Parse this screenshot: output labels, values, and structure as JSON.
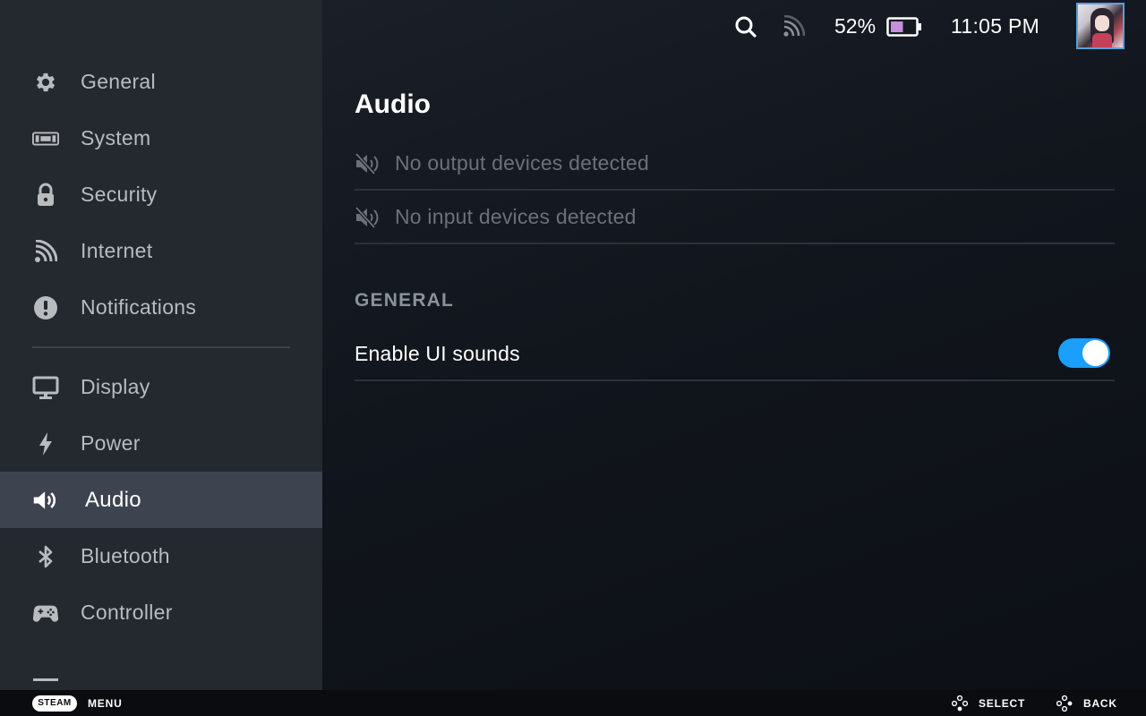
{
  "sidebar": {
    "items": [
      {
        "label": "General",
        "icon": "gear-icon"
      },
      {
        "label": "System",
        "icon": "system-icon"
      },
      {
        "label": "Security",
        "icon": "lock-icon"
      },
      {
        "label": "Internet",
        "icon": "wifi-icon"
      },
      {
        "label": "Notifications",
        "icon": "alert-icon"
      },
      {
        "label": "Display",
        "icon": "monitor-icon"
      },
      {
        "label": "Power",
        "icon": "lightning-icon"
      },
      {
        "label": "Audio",
        "icon": "speaker-icon",
        "active": true
      },
      {
        "label": "Bluetooth",
        "icon": "bluetooth-icon"
      },
      {
        "label": "Controller",
        "icon": "gamepad-icon"
      }
    ]
  },
  "status_bar": {
    "battery_percent": "52%",
    "battery_level": 0.52,
    "clock": "11:05 PM"
  },
  "main": {
    "title": "Audio",
    "devices": [
      {
        "label": "No output devices detected",
        "icon": "speaker-muted-icon"
      },
      {
        "label": "No input devices detected",
        "icon": "speaker-muted-icon"
      }
    ],
    "section_header": "GENERAL",
    "settings": [
      {
        "label": "Enable UI sounds",
        "enabled": true
      }
    ]
  },
  "bottom_bar": {
    "steam_label": "STEAM",
    "menu_label": "MENU",
    "select_label": "SELECT",
    "back_label": "BACK"
  },
  "colors": {
    "accent": "#1a9fff",
    "sidebar_bg": "#24282f",
    "active_bg": "#3d4450"
  }
}
